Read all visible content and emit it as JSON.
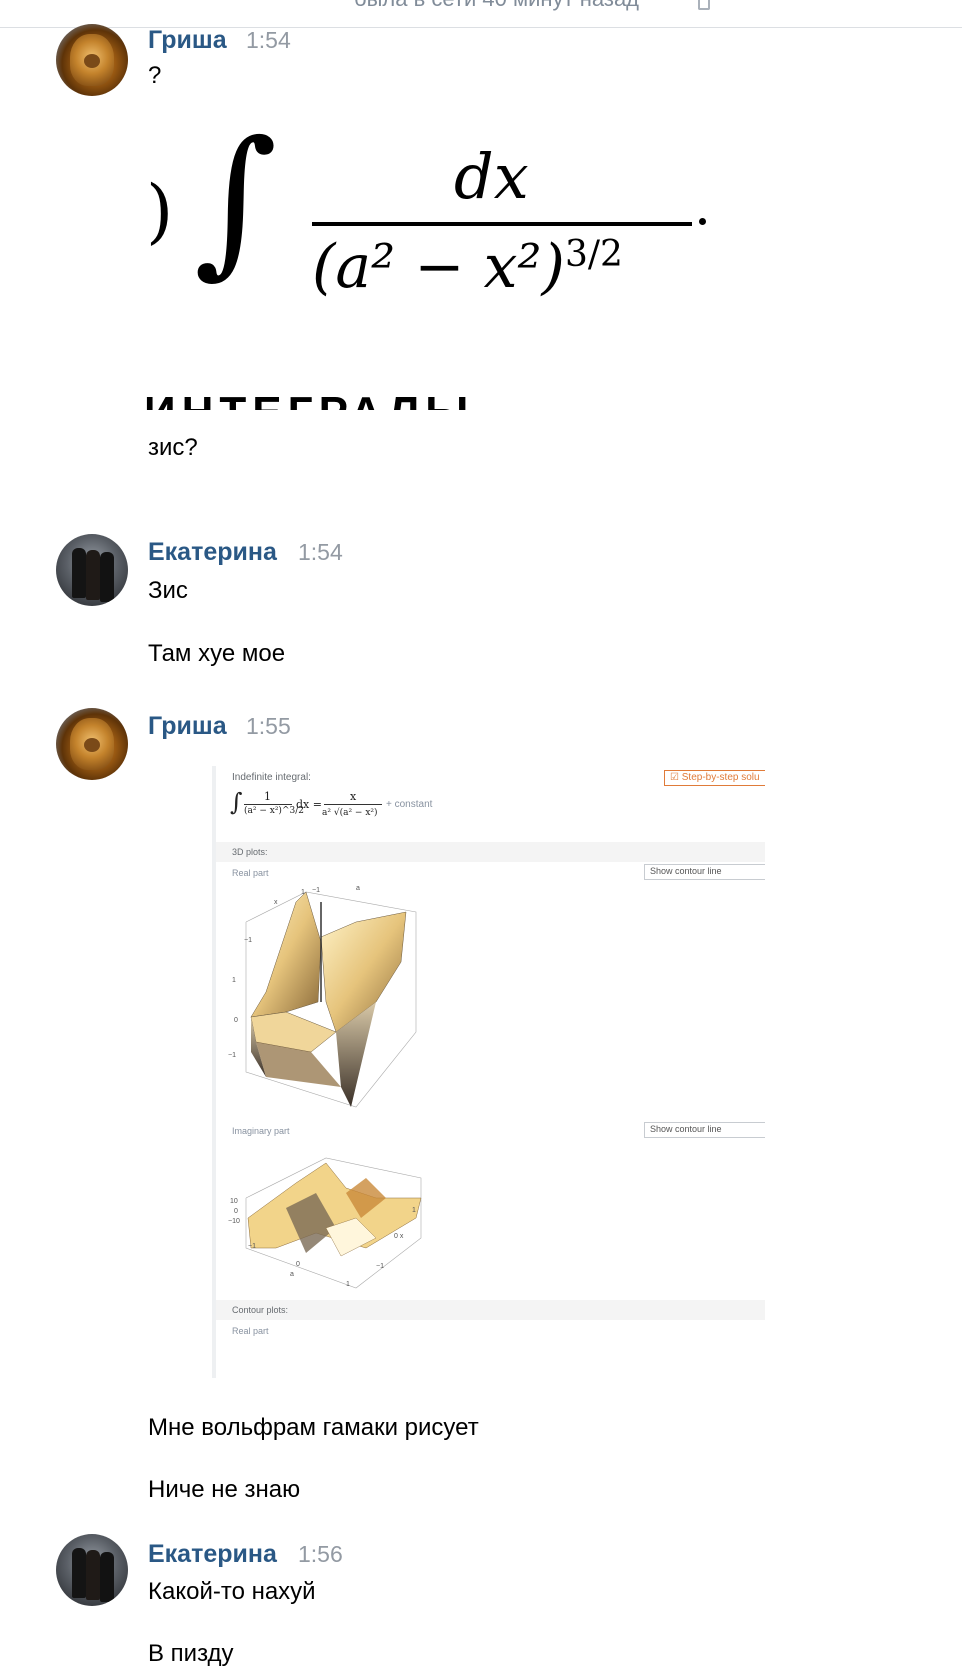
{
  "header": {
    "status_text": "была в сети 40 минут назад"
  },
  "messages": [
    {
      "author": "Гриша",
      "time": "1:54",
      "avatar": "lion-avatar",
      "texts": [
        "?",
        "зис?"
      ],
      "image": {
        "type": "integral-formula",
        "formula_numerator": "dx",
        "formula_denominator": "(a² − x²)",
        "formula_exponent": "3/2",
        "cut_text": "ИНТЕГРАЛЫ"
      }
    },
    {
      "author": "Екатерина",
      "time": "1:54",
      "avatar": "people-avatar",
      "texts": [
        "Зис",
        "Там хуе мое"
      ]
    },
    {
      "author": "Гриша",
      "time": "1:55",
      "avatar": "lion-avatar",
      "image": {
        "type": "wolfram-screenshot",
        "indefinite_integral_label": "Indefinite integral:",
        "step_by_step_label": "Step-by-step solu",
        "result_lhs_num": "1",
        "result_lhs_den": "(a² − x²)^3/2",
        "result_dx": "dx =",
        "result_rhs_num": "x",
        "result_rhs_den": "a² √(a² − x²)",
        "result_constant": "+ constant",
        "plots_3d_label": "3D plots:",
        "real_part_label": "Real part",
        "show_contour_label": "Show contour line",
        "imaginary_part_label": "Imaginary part",
        "contour_plots_label": "Contour plots:",
        "contour_real_part_label": "Real part"
      },
      "texts": [
        "Мне вольфрам гамаки рисует",
        "Ниче не знаю"
      ]
    },
    {
      "author": "Екатерина",
      "time": "1:56",
      "avatar": "people-avatar",
      "texts": [
        "Какой-то нахуй",
        "В пизду"
      ]
    }
  ],
  "colors": {
    "author": "#2a5885",
    "time": "#939aa3",
    "status": "#818c99"
  }
}
